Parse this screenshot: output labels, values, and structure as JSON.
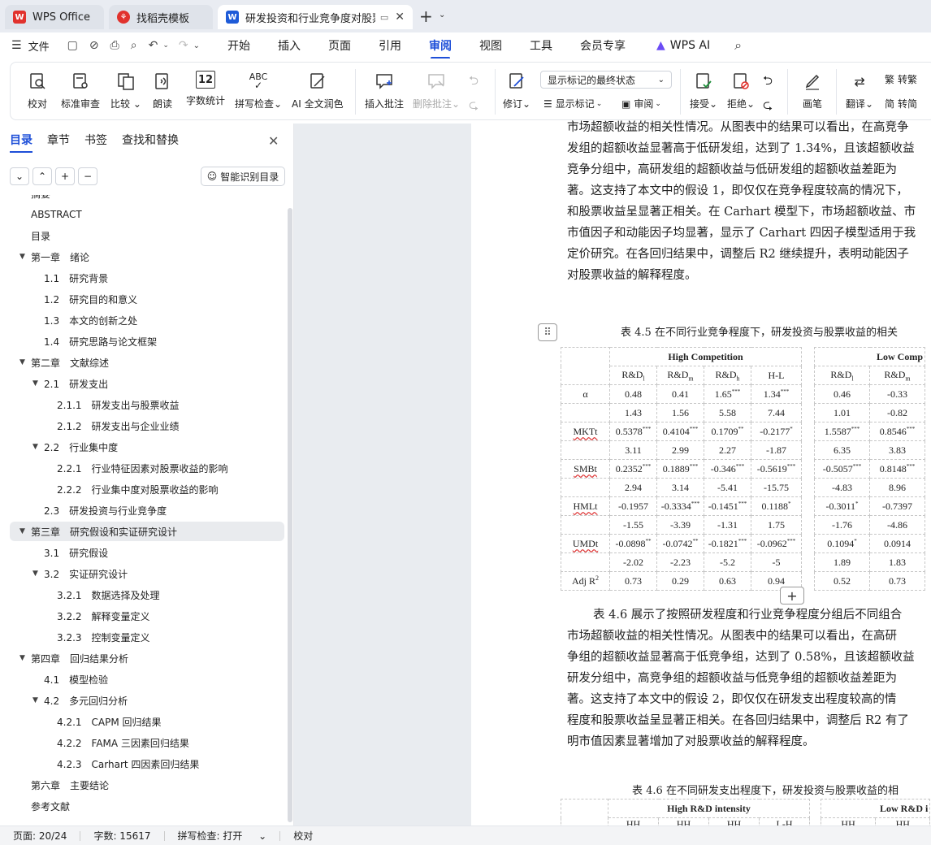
{
  "tabs": {
    "wps": "WPS Office",
    "template": "找稻壳模板",
    "doc": "研发投资和行业竞争度对股票"
  },
  "menu": {
    "file": "文件",
    "items": [
      "开始",
      "插入",
      "页面",
      "引用",
      "审阅",
      "视图",
      "工具",
      "会员专享"
    ],
    "wpsai": "WPS AI"
  },
  "ribbon": {
    "proofread": "校对",
    "std_review": "标准审查",
    "compare": "比较",
    "read_aloud": "朗读",
    "word_count": "字数统计",
    "spell_check": "拼写检查",
    "ai_polish": "AI 全文润色",
    "insert_comment": "插入批注",
    "delete_comment": "删除批注",
    "revise": "修订",
    "markup_select": "显示标记的最终状态",
    "show_markup": "显示标记",
    "review": "审阅",
    "accept": "接受",
    "reject": "拒绝",
    "pen": "画笔",
    "translate": "翻译",
    "to_traditional": "转繁",
    "to_simplified": "转简"
  },
  "nav": {
    "tabs": [
      "目录",
      "章节",
      "书签",
      "查找和替换"
    ],
    "smart_btn": "智能识别目录",
    "outline": [
      {
        "label": "摘要",
        "level": 0,
        "arrow": false
      },
      {
        "label": "ABSTRACT",
        "level": 0,
        "arrow": false
      },
      {
        "label": "目录",
        "level": 0,
        "arrow": false
      },
      {
        "label": "第一章　绪论",
        "level": 0,
        "arrow": true
      },
      {
        "label": "1.1　研究背景",
        "level": 1,
        "arrow": false
      },
      {
        "label": "1.2　研究目的和意义",
        "level": 1,
        "arrow": false
      },
      {
        "label": "1.3　本文的创新之处",
        "level": 1,
        "arrow": false
      },
      {
        "label": "1.4　研究思路与论文框架",
        "level": 1,
        "arrow": false
      },
      {
        "label": "第二章　文献综述",
        "level": 0,
        "arrow": true
      },
      {
        "label": "2.1　研发支出",
        "level": 1,
        "arrow": true
      },
      {
        "label": "2.1.1　研发支出与股票收益",
        "level": 2,
        "arrow": false
      },
      {
        "label": "2.1.2　研发支出与企业业绩",
        "level": 2,
        "arrow": false
      },
      {
        "label": "2.2　行业集中度",
        "level": 1,
        "arrow": true
      },
      {
        "label": "2.2.1　行业特征因素对股票收益的影响",
        "level": 2,
        "arrow": false
      },
      {
        "label": "2.2.2　行业集中度对股票收益的影响",
        "level": 2,
        "arrow": false
      },
      {
        "label": "2.3　研发投资与行业竞争度",
        "level": 1,
        "arrow": false
      },
      {
        "label": "第三章　研究假设和实证研究设计",
        "level": 0,
        "arrow": true,
        "highlight": true
      },
      {
        "label": "3.1　研究假设",
        "level": 1,
        "arrow": false
      },
      {
        "label": "3.2　实证研究设计",
        "level": 1,
        "arrow": true
      },
      {
        "label": "3.2.1　数据选择及处理",
        "level": 2,
        "arrow": false
      },
      {
        "label": "3.2.2　解释变量定义",
        "level": 2,
        "arrow": false
      },
      {
        "label": "3.2.3　控制变量定义",
        "level": 2,
        "arrow": false
      },
      {
        "label": "第四章　回归结果分析",
        "level": 0,
        "arrow": true
      },
      {
        "label": "4.1　模型检验",
        "level": 1,
        "arrow": false
      },
      {
        "label": "4.2　多元回归分析",
        "level": 1,
        "arrow": true
      },
      {
        "label": "4.2.1　CAPM 回归结果",
        "level": 2,
        "arrow": false
      },
      {
        "label": "4.2.2　FAMA 三因素回归结果",
        "level": 2,
        "arrow": false
      },
      {
        "label": "4.2.3　Carhart 四因素回归结果",
        "level": 2,
        "arrow": false
      },
      {
        "label": "第六章　主要结论",
        "level": 0,
        "arrow": false
      },
      {
        "label": "参考文献",
        "level": 0,
        "arrow": false
      }
    ]
  },
  "doc": {
    "para1": [
      "市场超额收益的相关性情况。从图表中的结果可以看出，在高竞争",
      "发组的超额收益显著高于低研发组，达到了 1.34%，且该超额收益",
      "竞争分组中，高研发组的超额收益与低研发组的超额收益差距为",
      "著。这支持了本文中的假设 1，即仅仅在竞争程度较高的情况下，",
      "和股票收益呈显著正相关。在 Carhart 模型下，市场超额收益、市",
      "市值因子和动能因子均显著，显示了 Carhart 四因子模型适用于我",
      "定价研究。在各回归结果中，调整后 R2 继续提升，表明动能因子",
      "对股票收益的解释程度。"
    ],
    "caption45": "表 4.5 在不同行业竞争程度下，研发投资与股票收益的相关",
    "table45": {
      "group_high": "High Competition",
      "group_low": "Low Comp",
      "cols": [
        "R&D",
        "R&D",
        "R&D",
        "H-L",
        "R&D",
        "R&D"
      ],
      "col_subs": [
        "l",
        "m",
        "h",
        "",
        "l",
        "m"
      ],
      "rows": [
        {
          "label": "α",
          "cells": [
            "0.48",
            "0.41",
            "1.65",
            "1.34",
            "0.46",
            "-0.33"
          ],
          "stars": [
            "",
            "",
            "***",
            "***",
            "",
            ""
          ]
        },
        {
          "label": "",
          "cells": [
            "1.43",
            "1.56",
            "5.58",
            "7.44",
            "1.01",
            "-0.82"
          ],
          "stars": [
            "",
            "",
            "",
            "",
            "",
            ""
          ]
        },
        {
          "label": "MKTt",
          "cells": [
            "0.5378",
            "0.4104",
            "0.1709",
            "-0.2177",
            "1.5587",
            "0.8546"
          ],
          "stars": [
            "***",
            "***",
            "**",
            "*",
            "***",
            "***"
          ]
        },
        {
          "label": "",
          "cells": [
            "3.11",
            "2.99",
            "2.27",
            "-1.87",
            "6.35",
            "3.83"
          ],
          "stars": [
            "",
            "",
            "",
            "",
            "",
            ""
          ]
        },
        {
          "label": "SMBt",
          "cells": [
            "0.2352",
            "0.1889",
            "-0.346",
            "-0.5619",
            "-0.5057",
            "0.8148"
          ],
          "stars": [
            "***",
            "***",
            "***",
            "***",
            "***",
            "***"
          ]
        },
        {
          "label": "",
          "cells": [
            "2.94",
            "3.14",
            "-5.41",
            "-15.75",
            "-4.83",
            "8.96"
          ],
          "stars": [
            "",
            "",
            "",
            "",
            "",
            ""
          ]
        },
        {
          "label": "HMLt",
          "cells": [
            "-0.1957",
            "-0.3334",
            "-0.1451",
            "0.1188",
            "-0.3011",
            "-0.7397"
          ],
          "stars": [
            "",
            "***",
            "***",
            "*",
            "*",
            ""
          ]
        },
        {
          "label": "",
          "cells": [
            "-1.55",
            "-3.39",
            "-1.31",
            "1.75",
            "-1.76",
            "-4.86"
          ],
          "stars": [
            "",
            "",
            "",
            "",
            "",
            ""
          ]
        },
        {
          "label": "UMDt",
          "cells": [
            "-0.0898",
            "-0.0742",
            "-0.1821",
            "-0.0962",
            "0.1094",
            "0.0914"
          ],
          "stars": [
            "**",
            "**",
            "***",
            "***",
            "*",
            ""
          ]
        },
        {
          "label": "",
          "cells": [
            "-2.02",
            "-2.23",
            "-5.2",
            "-5",
            "1.89",
            "1.83"
          ],
          "stars": [
            "",
            "",
            "",
            "",
            "",
            ""
          ]
        },
        {
          "label": "Adj R",
          "cells": [
            "0.73",
            "0.29",
            "0.63",
            "0.94",
            "0.52",
            "0.73"
          ],
          "stars": [
            "",
            "",
            "",
            "",
            "",
            ""
          ]
        }
      ],
      "adj_sup": "2"
    },
    "para2": [
      "表 4.6 展示了按照研发程度和行业竞争程度分组后不同组合",
      "市场超额收益的相关性情况。从图表中的结果可以看出，在高研",
      "争组的超额收益显著高于低竞争组，达到了 0.58%，且该超额收益",
      "研发分组中，高竞争组的超额收益与低竞争组的超额收益差距为",
      "著。这支持了本文中的假设 2，即仅仅在研发支出程度较高的情",
      "程度和股票收益呈显著正相关。在各回归结果中，调整后 R2 有了",
      "明市值因素显著增加了对股票收益的解释程度。"
    ],
    "caption46": "表 4.6 在不同研发支出程度下，研发投资与股票收益的相",
    "table46": {
      "group_high": "High R&D intensity",
      "group_low": "Low R&D i",
      "partial_row": [
        "HH",
        "HH",
        "HH",
        "L-H",
        "HH",
        "HH"
      ]
    }
  },
  "status": {
    "page": "页面: 20/24",
    "words": "字数: 15617",
    "spell": "拼写检查: 打开",
    "proof": "校对"
  },
  "colors": {
    "accent": "#1e4fd8",
    "wps_red": "#e1322d"
  }
}
